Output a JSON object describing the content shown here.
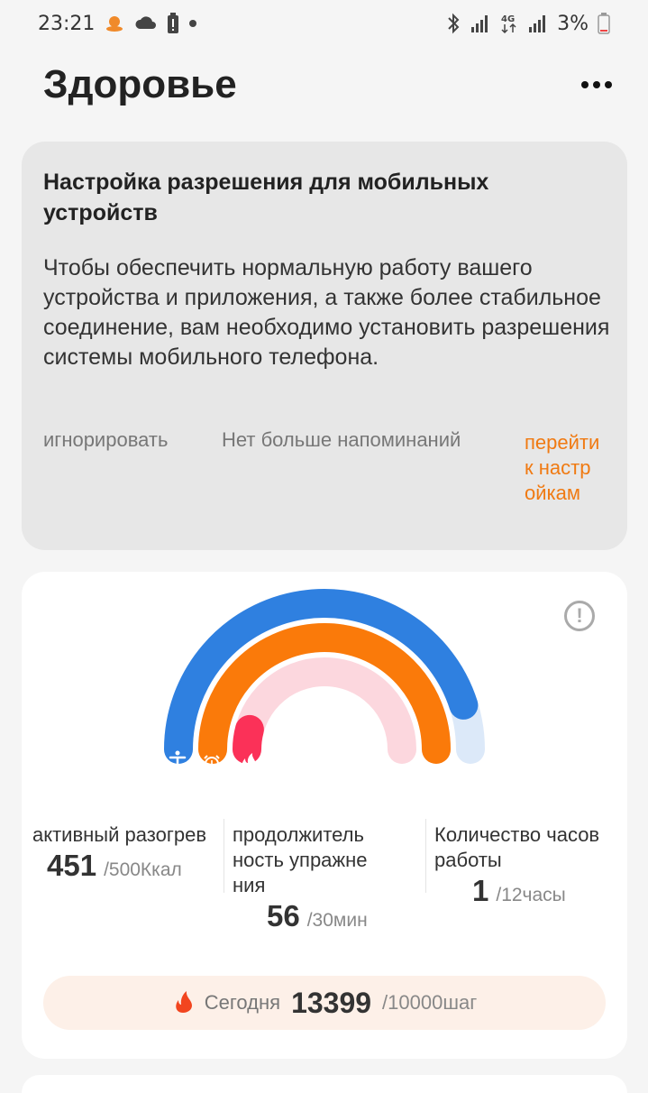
{
  "status_bar": {
    "time": "23:21",
    "battery": "3%",
    "icons_left": [
      "weather-avatar-icon",
      "cloud-icon",
      "battery-alert-icon",
      "dot-icon"
    ],
    "icons_right": [
      "bluetooth-icon",
      "signal-icon",
      "4g-icon",
      "signal-icon",
      "battery-icon"
    ]
  },
  "header": {
    "title": "Здоровье"
  },
  "permission_card": {
    "title": "Настройка разрешения для мобильных устройств",
    "text": "Чтобы обеспечить нормальную работу вашего устройства и приложения, а также более стабильное соединение, вам необходимо установить разрешения системы мобильного телефона.",
    "ignore_label": "игнорировать",
    "no_remind_label": "Нет больше напоминаний",
    "goto_label": "перейти к настройкам"
  },
  "activity": {
    "rings": [
      {
        "name": "active-warmup",
        "color": "#2f80e0",
        "track": "#dce9f9",
        "progress": 0.902
      },
      {
        "name": "exercise-duration",
        "color": "#fa7a0a",
        "track": "#fde3cf",
        "progress": 1.0
      },
      {
        "name": "work-hours",
        "color": "#fb3158",
        "track": "#fcd7de",
        "progress": 0.083
      }
    ],
    "metrics": [
      {
        "label": "активный разогрев",
        "value": "451",
        "goal": "/500Ккал"
      },
      {
        "label": "продолжительность упражнения",
        "value": "56",
        "goal": "/30мин"
      },
      {
        "label": "Количество часов работы",
        "value": "1",
        "goal": "/12часы"
      }
    ],
    "today": {
      "label": "Сегодня",
      "value": "13399",
      "goal": "/10000шаг"
    }
  },
  "colors": {
    "accent_orange": "#f07a12",
    "ring_blue": "#2f80e0",
    "ring_orange": "#fa7a0a",
    "ring_red": "#fb3158"
  }
}
